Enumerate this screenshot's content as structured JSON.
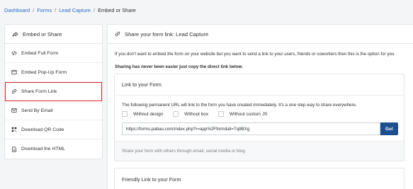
{
  "breadcrumb": {
    "items": [
      "Dashboard",
      "Forms",
      "Lead Capture"
    ],
    "separator": "/",
    "current": "Embed or Share"
  },
  "sidebar": {
    "title": "Embed or Share",
    "title_icon": "share-icon",
    "items": [
      {
        "label": "Embed Full Form",
        "icon": "code-icon"
      },
      {
        "label": "Embed Pop-Up Form",
        "icon": "window-icon"
      },
      {
        "label": "Share Form Link",
        "icon": "link-icon",
        "active": true
      },
      {
        "label": "Send By Email",
        "icon": "envelope-icon"
      },
      {
        "label": "Download QR Code",
        "icon": "qrcode-icon"
      },
      {
        "label": "Download the HTML",
        "icon": "file-icon"
      }
    ]
  },
  "main": {
    "title": "Share your form link: Lead Capture",
    "title_icon": "link-icon",
    "intro": "If you don't want to embed the form on your website but you want to send a link to your users, friends or coworkers then this is the option for you.",
    "intro_bold": "Sharing has never been easier just copy the direct link below.",
    "link_card": {
      "title": "Link to your Form",
      "description": "The following permanent URL will link to the form you have created immediately. It's a one step way to share everywhere.",
      "options": [
        "Without design",
        "Without box",
        "Without custom JS"
      ],
      "url": "https://forms.pabau.com/index.php?r=app%2Fform&id=Tq8BXg",
      "go_label": "Go!",
      "footer": "Share your form with others through email, social media or blog."
    },
    "friendly_card": {
      "title": "Friendly Link to your Form"
    }
  },
  "colors": {
    "link": "#2a6bc2",
    "active_outline": "#d9262a",
    "go_button": "#1d4f8f"
  }
}
